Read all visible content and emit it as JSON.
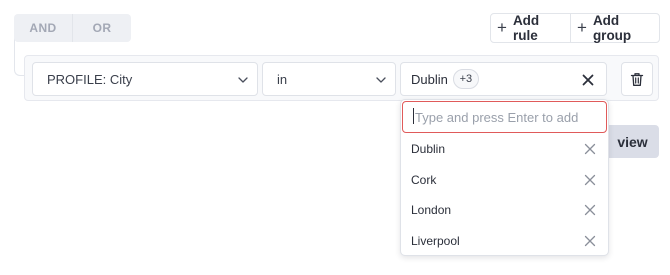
{
  "combinator": {
    "and_label": "AND",
    "or_label": "OR"
  },
  "actions": {
    "add_rule_label": "Add rule",
    "add_group_label": "Add group"
  },
  "rule": {
    "field_value": "PROFILE: City",
    "operator_value": "in",
    "first_value": "Dublin",
    "more_count": "+3"
  },
  "preview": {
    "label": "view"
  },
  "dropdown": {
    "placeholder": "Type and press Enter to add",
    "items": [
      {
        "label": "Dublin"
      },
      {
        "label": "Cork"
      },
      {
        "label": "London"
      },
      {
        "label": "Liverpool"
      }
    ]
  },
  "icons": {
    "chevron": "chevron-down-icon",
    "clear": "close-icon",
    "delete": "trash-icon",
    "add": "plus-icon"
  },
  "colors": {
    "input_focus": "#e05a5a",
    "preview_bg": "#dadde7"
  }
}
